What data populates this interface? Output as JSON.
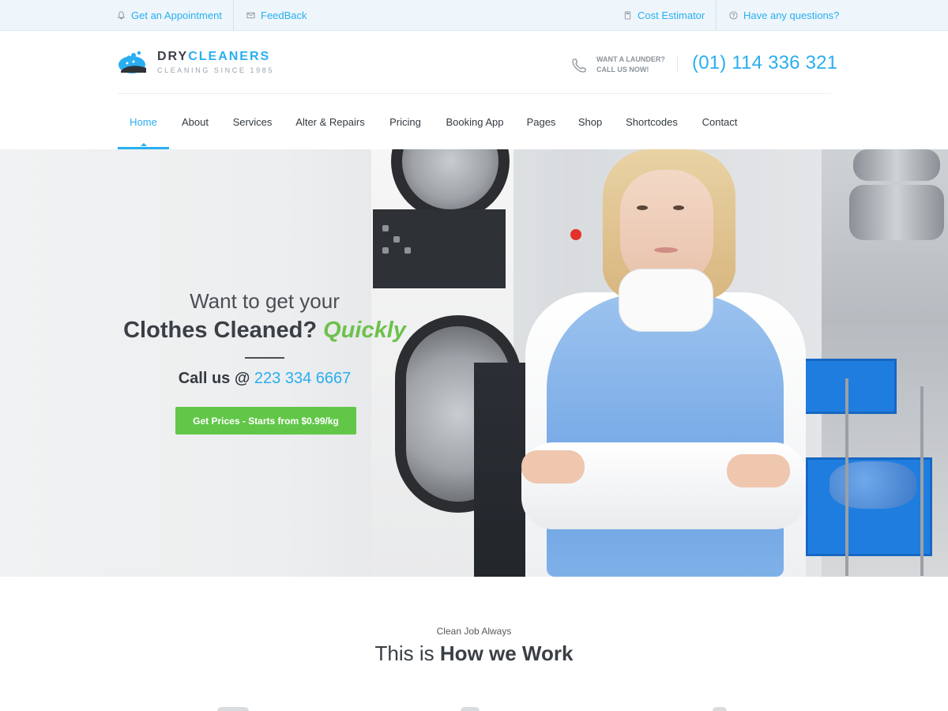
{
  "topbar": {
    "appointment": "Get an Appointment",
    "feedback": "FeedBack",
    "estimator": "Cost Estimator",
    "questions": "Have any questions?"
  },
  "logo": {
    "word_dark": "DRY",
    "word_accent": "CLEANERS",
    "tagline": "CLEANING SINCE 1985"
  },
  "header": {
    "call_line1": "WANT A LAUNDER?",
    "call_line2": "CALL US NOW!",
    "phone": "(01) 114 336 321"
  },
  "nav": {
    "items": [
      "Home",
      "About",
      "Services",
      "Alter & Repairs",
      "Pricing",
      "Booking App",
      "Pages",
      "Shop",
      "Shortcodes",
      "Contact"
    ],
    "active": "Home"
  },
  "hero": {
    "line1": "Want to get your",
    "line2_main": "Clothes Cleaned?",
    "line2_accent": "Quickly",
    "call_prefix": "Call us @",
    "call_number": "223 334 6667",
    "cta": "Get Prices - Starts from $0.99/kg"
  },
  "section": {
    "subtitle": "Clean Job Always",
    "title_light": "This is",
    "title_bold": "How we Work"
  },
  "colors": {
    "accent": "#29aef0",
    "green": "#62c749",
    "topbar_bg": "#eef6fc"
  }
}
